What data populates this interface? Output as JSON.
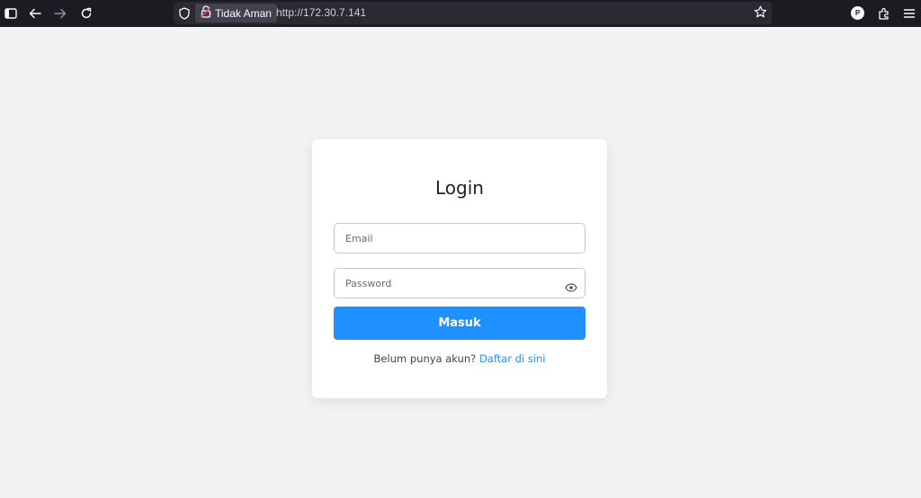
{
  "browser": {
    "security_label": "Tidak Aman",
    "url": "http://172.30.7.141",
    "profile_initial": "P"
  },
  "login": {
    "title": "Login",
    "email_placeholder": "Email",
    "password_placeholder": "Password",
    "submit_label": "Masuk",
    "signup_prompt": "Belum punya akun?",
    "signup_link": "Daftar di sini"
  },
  "colors": {
    "accent": "#1e90ff",
    "page_bg": "#f1f2f4",
    "toolbar_bg": "#1c1b22"
  }
}
